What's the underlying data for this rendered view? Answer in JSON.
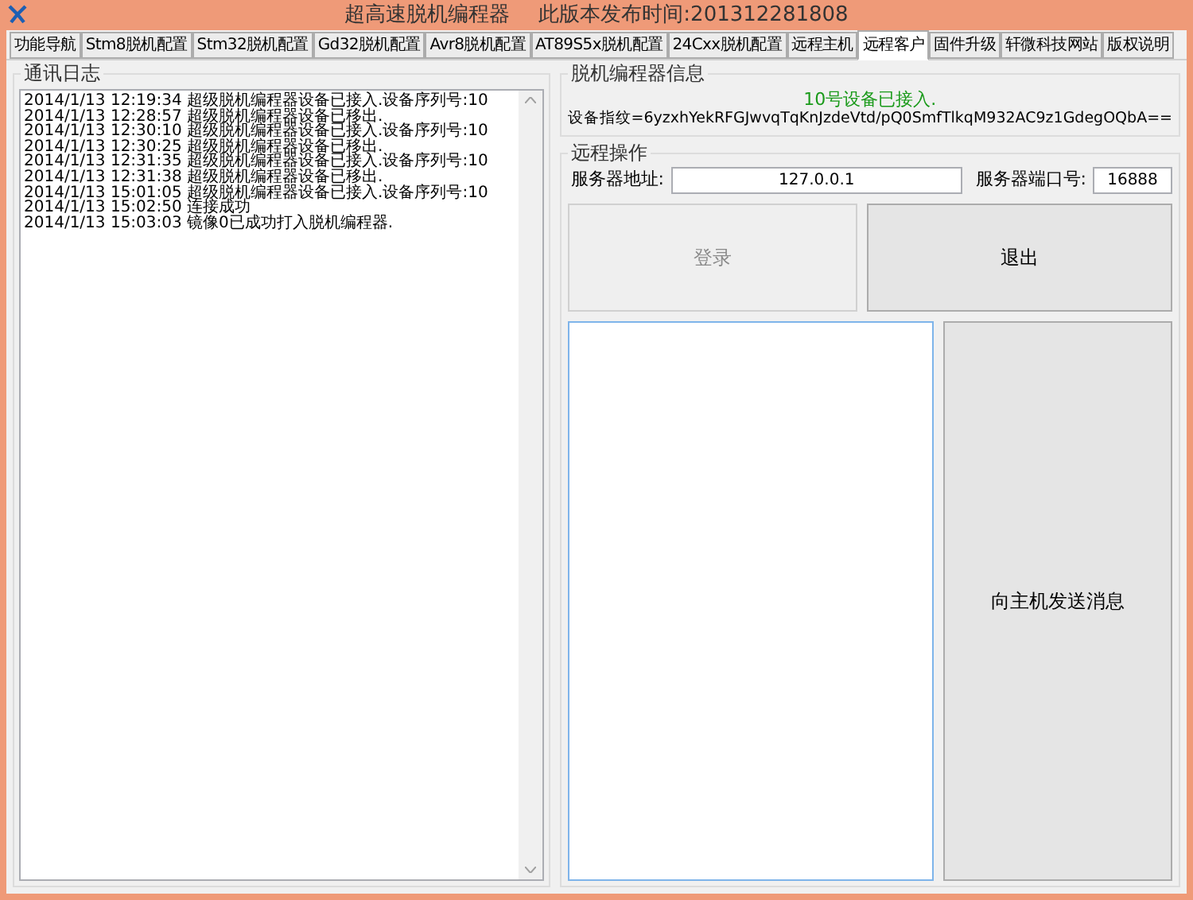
{
  "window": {
    "title": "超高速脱机编程器",
    "subtitle": "此版本发布时间:201312281808"
  },
  "tabs": [
    {
      "label": "功能导航",
      "selected": false
    },
    {
      "label": "Stm8脱机配置",
      "selected": false
    },
    {
      "label": "Stm32脱机配置",
      "selected": false
    },
    {
      "label": "Gd32脱机配置",
      "selected": false
    },
    {
      "label": "Avr8脱机配置",
      "selected": false
    },
    {
      "label": "AT89S5x脱机配置",
      "selected": false
    },
    {
      "label": "24Cxx脱机配置",
      "selected": false
    },
    {
      "label": "远程主机",
      "selected": false
    },
    {
      "label": "远程客户",
      "selected": true
    },
    {
      "label": "固件升级",
      "selected": false
    },
    {
      "label": "轩微科技网站",
      "selected": false
    },
    {
      "label": "版权说明",
      "selected": false
    }
  ],
  "log": {
    "title": "通讯日志",
    "lines": [
      "2014/1/13 12:19:34 超级脱机编程器设备已接入.设备序列号:10",
      "2014/1/13 12:28:57 超级脱机编程器设备已移出.",
      "2014/1/13 12:30:10 超级脱机编程器设备已接入.设备序列号:10",
      "2014/1/13 12:30:25 超级脱机编程器设备已移出.",
      "2014/1/13 12:31:35 超级脱机编程器设备已接入.设备序列号:10",
      "2014/1/13 12:31:38 超级脱机编程器设备已移出.",
      "2014/1/13 15:01:05 超级脱机编程器设备已接入.设备序列号:10",
      "2014/1/13 15:02:50 连接成功",
      "2014/1/13 15:03:03 镜像0已成功打入脱机编程器."
    ]
  },
  "device_info": {
    "title": "脱机编程器信息",
    "status": "10号设备已接入.",
    "fingerprint": "设备指纹=6yzxhYekRFGJwvqTqKnJzdeVtd/pQ0SmfTlkqM932AC9z1GdegOQbA=="
  },
  "remote": {
    "title": "远程操作",
    "server_label": "服务器地址:",
    "server_value": "127.0.0.1",
    "port_label": "服务器端口号:",
    "port_value": "16888",
    "login": {
      "label": "登录",
      "disabled": true
    },
    "logout": {
      "label": "退出",
      "disabled": false
    },
    "send": {
      "label": "向主机发送消息",
      "disabled": false
    }
  }
}
